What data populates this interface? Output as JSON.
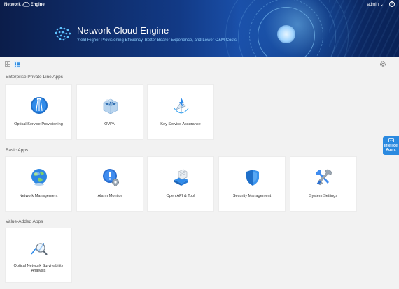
{
  "header": {
    "logo_left": "Network",
    "logo_right": "Engine",
    "user": "admin",
    "user_caret": "⌄",
    "help_icon": "?",
    "title": "Network Cloud Engine",
    "subtitle": "Yield Higher Provisioning Efficiency, Better Bearer Experience, and Lower O&M Costs"
  },
  "toolbar": {
    "grid_view_icon": "grid-view-icon",
    "list_view_icon": "list-view-icon",
    "settings_icon": "gear-icon"
  },
  "sections": [
    {
      "title": "Enterprise Private Line Apps",
      "apps": [
        {
          "label": "Optical Service Provisioning",
          "icon": "fiber-optic-icon"
        },
        {
          "label": "OVPN",
          "icon": "network-box-icon"
        },
        {
          "label": "Key Service Assurance",
          "icon": "satellite-assurance-icon"
        }
      ]
    },
    {
      "title": "Basic Apps",
      "apps": [
        {
          "label": "Network Management",
          "icon": "globe-icon"
        },
        {
          "label": "Alarm Monitor",
          "icon": "alarm-gear-icon"
        },
        {
          "label": "Open API & Tool",
          "icon": "server-api-icon"
        },
        {
          "label": "Security Management",
          "icon": "shield-icon"
        },
        {
          "label": "System Settings",
          "icon": "tools-icon"
        }
      ]
    },
    {
      "title": "Value-Added Apps",
      "apps": [
        {
          "label": "Optical Network Survivability Analysis",
          "icon": "analysis-chart-icon"
        }
      ]
    }
  ],
  "agent": {
    "line1": "Intellige",
    "line2": "Agent"
  },
  "colors": {
    "accent": "#2b8ae0",
    "banner": "#123a86",
    "subtitle": "#8fd0ff"
  }
}
